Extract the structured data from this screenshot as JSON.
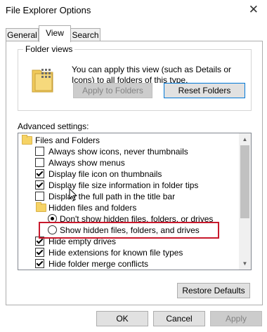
{
  "window": {
    "title": "File Explorer Options"
  },
  "tabs": [
    {
      "label": "General",
      "selected": false
    },
    {
      "label": "View",
      "selected": true
    },
    {
      "label": "Search",
      "selected": false
    }
  ],
  "folder_views": {
    "label": "Folder views",
    "description": "You can apply this view (such as Details or Icons) to all folders of this type.",
    "apply_label": "Apply to Folders",
    "reset_label": "Reset Folders"
  },
  "advanced": {
    "label": "Advanced settings:",
    "items": [
      {
        "type": "folder",
        "label": "Files and Folders"
      },
      {
        "type": "checkbox",
        "label": "Always show icons, never thumbnails",
        "checked": false
      },
      {
        "type": "checkbox",
        "label": "Always show menus",
        "checked": false
      },
      {
        "type": "checkbox",
        "label": "Display file icon on thumbnails",
        "checked": true
      },
      {
        "type": "checkbox",
        "label": "Display file size information in folder tips",
        "checked": true
      },
      {
        "type": "checkbox",
        "label": "Display the full path in the title bar",
        "checked": false
      },
      {
        "type": "folder",
        "label": "Hidden files and folders"
      },
      {
        "type": "radio",
        "label": "Don't show hidden files, folders, or drives",
        "selected": true
      },
      {
        "type": "radio",
        "label": "Show hidden files, folders, and drives",
        "selected": false
      },
      {
        "type": "checkbox",
        "label": "Hide empty drives",
        "checked": true
      },
      {
        "type": "checkbox",
        "label": "Hide extensions for known file types",
        "checked": true
      },
      {
        "type": "checkbox",
        "label": "Hide folder merge conflicts",
        "checked": true
      }
    ],
    "restore_label": "Restore Defaults"
  },
  "footer": {
    "ok_label": "OK",
    "cancel_label": "Cancel",
    "apply_label": "Apply"
  },
  "icons": {
    "close": "close-icon",
    "folder": "folder-icon",
    "scroll_up": "chevron-up-icon",
    "scroll_down": "chevron-down-icon",
    "cursor": "mouse-cursor-icon"
  },
  "colors": {
    "highlight_box": "#c8192c",
    "focus_border": "#0078d7"
  }
}
